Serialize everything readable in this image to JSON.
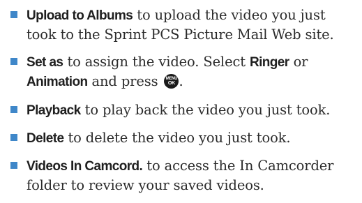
{
  "colors": {
    "bullet": "#3f87c9",
    "text": "#2b2b2b",
    "term": "#1f1f1f"
  },
  "items": [
    {
      "term": "Upload to Albums",
      "text": " to upload the video you just took to the Sprint PCS Picture Mail Web site."
    },
    {
      "term": "Set as",
      "text_before": " to assign the video. Select ",
      "term2": "Ringer",
      "text_mid": " or ",
      "term3": "Animation",
      "text_after": " and press ",
      "text_end": "."
    },
    {
      "term": "Playback",
      "text": " to play back the video you just took."
    },
    {
      "term": "Delete",
      "text": " to delete the video you just took."
    },
    {
      "term": "Videos In Camcord.",
      "text": " to access the In Camcorder folder to review your saved videos."
    }
  ],
  "menu_key": {
    "icon": "menu-ok-key-icon",
    "line1": "MENU",
    "line2": "OK"
  }
}
